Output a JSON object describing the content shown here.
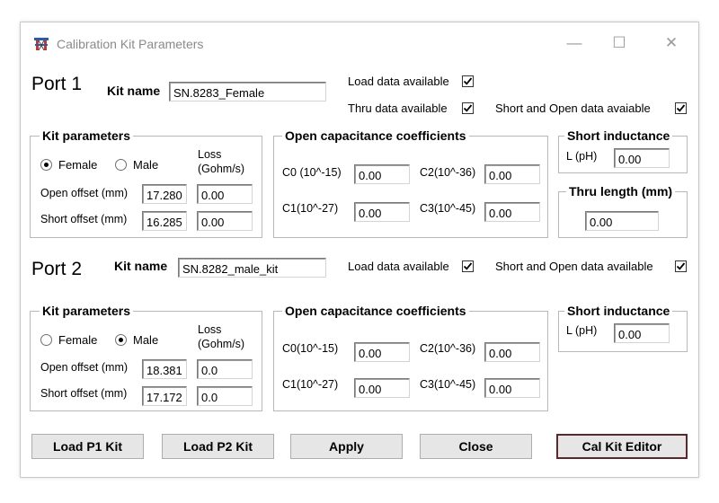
{
  "window": {
    "title": "Calibration Kit Parameters",
    "minimize": "—",
    "maximize": "☐",
    "close": "✕"
  },
  "port1": {
    "label": "Port 1",
    "kit_name_label": "Kit name",
    "kit_name_value": "SN.8283_Female",
    "load_data_label": "Load data available",
    "load_data_checked": true,
    "thru_data_label": "Thru data available",
    "thru_data_checked": true,
    "short_open_label": "Short and Open data avaiable",
    "short_open_checked": true,
    "kit_params": {
      "title": "Kit parameters",
      "female_label": "Female",
      "male_label": "Male",
      "selected": "Female",
      "loss_label_1": "Loss",
      "loss_label_2": "(Gohm/s)",
      "open_offset_label": "Open offset (mm)",
      "open_offset_value": "17.280",
      "open_loss_value": "0.00",
      "short_offset_label": "Short offset (mm)",
      "short_offset_value": "16.285",
      "short_loss_value": "0.00"
    },
    "open_cap": {
      "title": "Open capacitance coefficients",
      "c0_label": "C0 (10^-15)",
      "c0_value": "0.00",
      "c1_label": "C1(10^-27)",
      "c1_value": "0.00",
      "c2_label": "C2(10^-36)",
      "c2_value": "0.00",
      "c3_label": "C3(10^-45)",
      "c3_value": "0.00"
    },
    "short_ind": {
      "title": "Short inductance",
      "label": "L (pH)",
      "value": "0.00"
    },
    "thru_length": {
      "title": "Thru length (mm)",
      "value": "0.00"
    }
  },
  "port2": {
    "label": "Port 2",
    "kit_name_label": "Kit name",
    "kit_name_value": "SN.8282_male_kit",
    "load_data_label": "Load data available",
    "load_data_checked": true,
    "short_open_label": "Short and Open data available",
    "short_open_checked": true,
    "kit_params": {
      "title": "Kit parameters",
      "female_label": "Female",
      "male_label": "Male",
      "selected": "Male",
      "loss_label_1": "Loss",
      "loss_label_2": "(Gohm/s)",
      "open_offset_label": "Open offset (mm)",
      "open_offset_value": "18.381",
      "open_loss_value": "0.0",
      "short_offset_label": "Short offset (mm)",
      "short_offset_value": "17.172",
      "short_loss_value": "0.0"
    },
    "open_cap": {
      "title": "Open capacitance coefficients",
      "c0_label": "C0(10^-15)",
      "c0_value": "0.00",
      "c1_label": "C1(10^-27)",
      "c1_value": "0.00",
      "c2_label": "C2(10^-36)",
      "c2_value": "0.00",
      "c3_label": "C3(10^-45)",
      "c3_value": "0.00"
    },
    "short_ind": {
      "title": "Short inductance",
      "label": "L (pH)",
      "value": "0.00"
    }
  },
  "buttons": {
    "load_p1": "Load P1 Kit",
    "load_p2": "Load P2 Kit",
    "apply": "Apply",
    "close": "Close",
    "cal_kit_editor": "Cal Kit Editor"
  },
  "colors": {
    "title_text": "#8a8a8a",
    "group_border": "#b8b8b8",
    "button_face": "#e6e6e6",
    "default_button_border": "#5a2a2a"
  }
}
